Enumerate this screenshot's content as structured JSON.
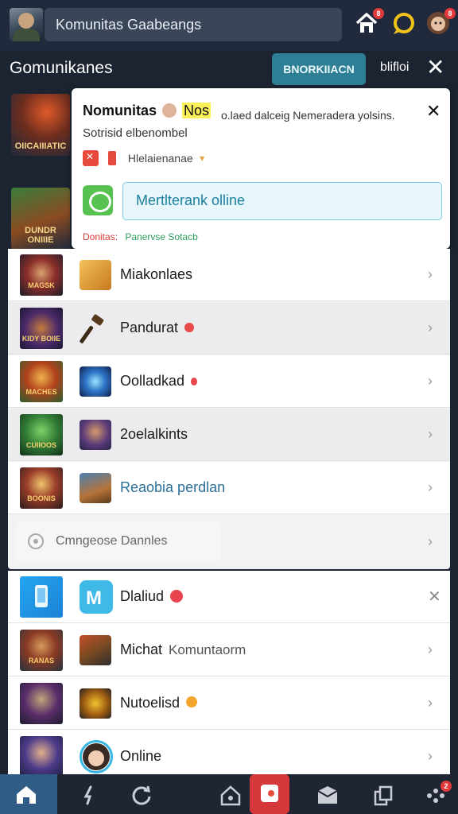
{
  "topbar": {
    "search_text": "Komunitas Gaabeangs",
    "notif_badge": "8",
    "profile_badge": "8"
  },
  "header": {
    "title": "Gomunikanes",
    "action_button": "BNORKIIACN",
    "more": "blifloi",
    "close": "✕"
  },
  "background_tiles": [
    {
      "label": "OIICAIIIATIC"
    },
    {
      "label": "DUNDR ONIIIE"
    }
  ],
  "popup": {
    "title": "Nomunitas",
    "title_highlight": "Nos",
    "description": "o.laed dalceig Nemeradera yolsins.",
    "subtitle": "Sotrisid elbenombel",
    "row_text": "Hlelaienanae",
    "online_button": "Mertlterank olline",
    "footer_red": "Donitas:",
    "footer_green": "Panervse Sotacb",
    "close": "✕"
  },
  "list1": [
    {
      "label": "Miakonlaes",
      "art_label": "MAGSK",
      "chevron": "›"
    },
    {
      "label": "Pandurat",
      "art_label": "KIDY BOIIE",
      "chevron": "›"
    },
    {
      "label": "Oolladkad",
      "art_label": "MACHES",
      "chevron": "›"
    },
    {
      "label": "2oelalkints",
      "art_label": "CUIIOOS",
      "chevron": "›"
    },
    {
      "label": "Reaobia perdlan",
      "art_label": "BOONIS",
      "chevron": "›"
    }
  ],
  "compact_field": {
    "placeholder": "Cmngeose Dannles",
    "chevron": "›"
  },
  "list2": [
    {
      "label": "Dlaliud",
      "sub": "",
      "art_label": "",
      "trailing": "✕"
    },
    {
      "label": "Michat",
      "sub": "Komuntaorm",
      "art_label": "RANAS",
      "trailing": "›"
    },
    {
      "label": "Nutoelisd",
      "sub": "",
      "art_label": "",
      "trailing": "›"
    },
    {
      "label": "Online",
      "sub": "",
      "art_label": "",
      "trailing": "›"
    }
  ],
  "bottomnav": {
    "badge": "2"
  },
  "colors": {
    "top_bg": "#202a3c",
    "accent_teal": "#2e7f95",
    "nav_active": "#2f5d86",
    "nav_center": "#d5383a",
    "online_text": "#1b7f9e"
  }
}
